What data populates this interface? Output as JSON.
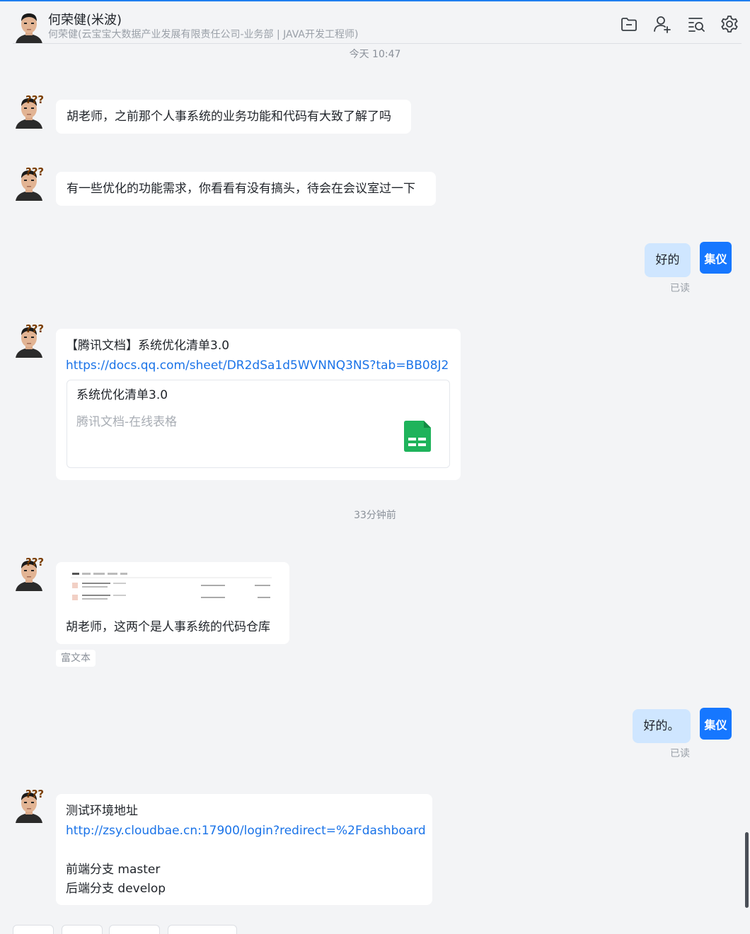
{
  "header": {
    "name": "何荣健(米波)",
    "subtitle": "何荣健(云宝宝大数据产业发展有限责任公司-业务部 | JAVA开发工程师)",
    "icons": [
      "folder-icon",
      "add-user-icon",
      "search-history-icon",
      "settings-icon"
    ]
  },
  "timestamps": {
    "first": "今天 10:47",
    "second": "33分钟前"
  },
  "messages": {
    "m1": "胡老师，之前那个人事系统的业务功能和代码有大致了解了吗",
    "m2": "有一些优化的功能需求，你看看有没有搞头，待会在会议室过一下",
    "m3": "好的",
    "m3_read": "已读",
    "me_avatar_label": "集仪",
    "m4_title": "【腾讯文档】系统优化清单3.0",
    "m4_link": "https://docs.qq.com/sheet/DR2dSa1d5WVNNQ3NS?tab=BB08J2",
    "m4_card_title": "系统优化清单3.0",
    "m4_card_sub": "腾讯文档-在线表格",
    "m5_text": "胡老师，这两个是人事系统的代码仓库",
    "m5_tag": "富文本",
    "m6": "好的。",
    "m6_read": "已读",
    "m7_line1": "测试环境地址",
    "m7_link": "http://zsy.cloudbae.cn:17900/login?redirect=%2Fdashboard",
    "m7_line3": "前端分支 master",
    "m7_line4": "后端分支 develop"
  },
  "colors": {
    "accent": "#1677ff",
    "my_bubble": "#cfe6ff",
    "link": "#1a73e8",
    "background": "#f3f4f6",
    "sheet_green": "#1fb35b"
  }
}
